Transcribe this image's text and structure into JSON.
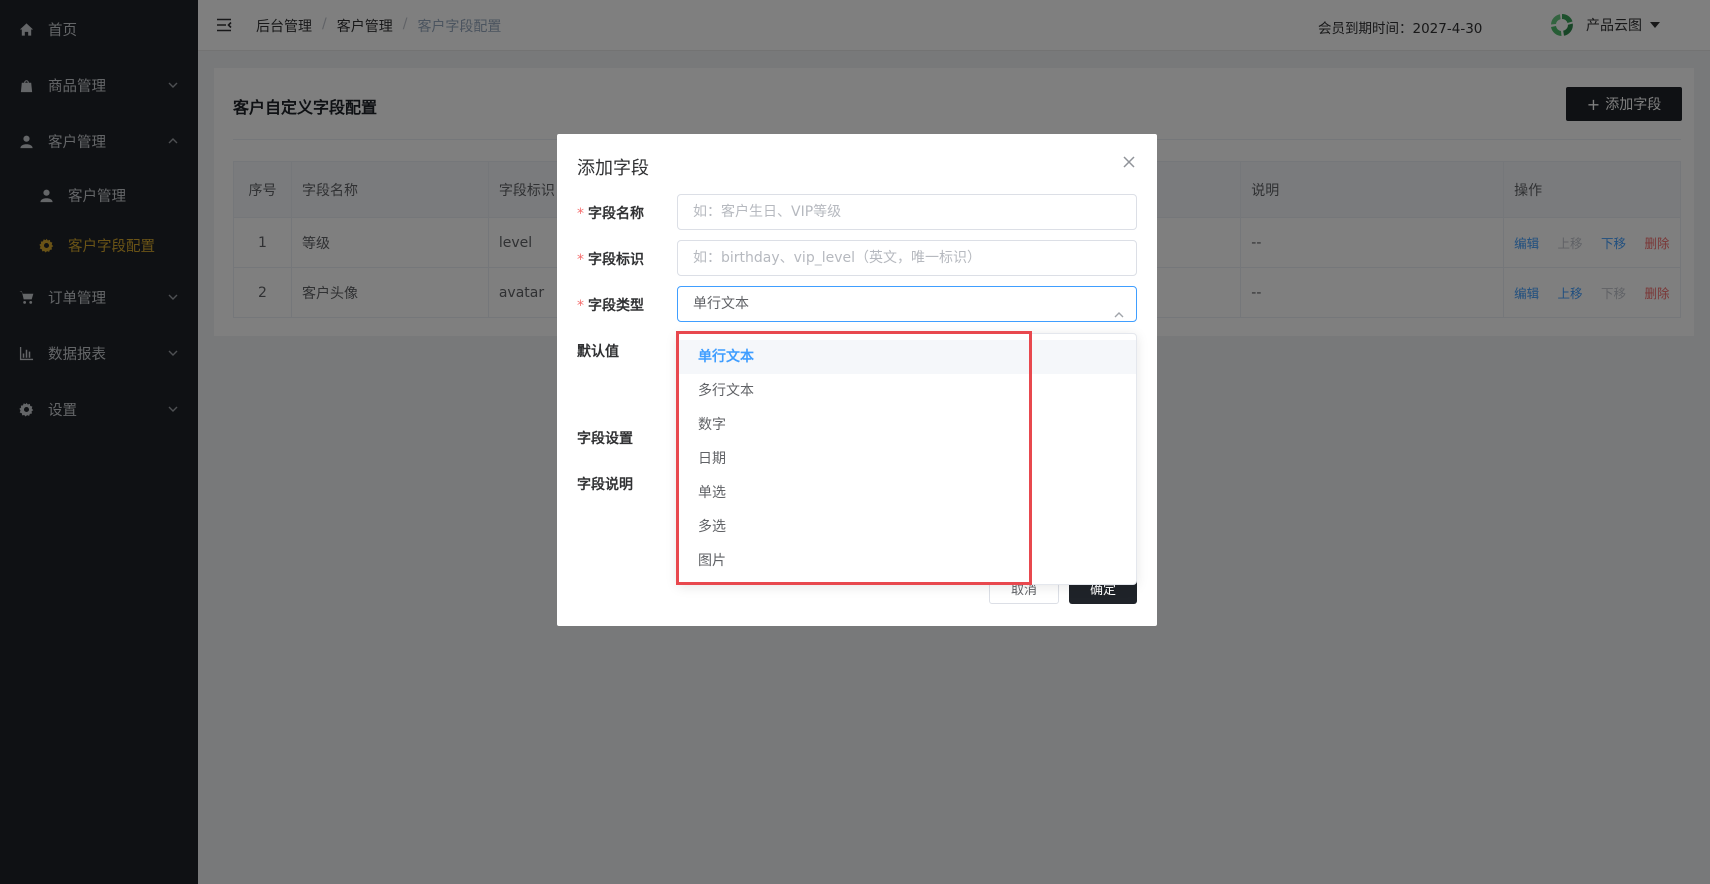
{
  "sidebar": {
    "items": [
      {
        "label": "首页",
        "icon": "home-icon"
      },
      {
        "label": "商品管理",
        "icon": "bag-icon"
      },
      {
        "label": "客户管理",
        "icon": "user-icon"
      },
      {
        "label": "客户管理",
        "icon": "user-icon"
      },
      {
        "label": "客户字段配置",
        "icon": "gear-icon"
      },
      {
        "label": "订单管理",
        "icon": "cart-icon"
      },
      {
        "label": "数据报表",
        "icon": "chart-icon"
      },
      {
        "label": "设置",
        "icon": "gear-icon"
      }
    ],
    "active_color": "#d4a72c"
  },
  "header": {
    "breadcrumb": [
      "后台管理",
      "客户管理",
      "客户字段配置"
    ],
    "separator": "/",
    "expire_label": "会员到期时间：2027-4-30",
    "user_name": "产品云图"
  },
  "card": {
    "title": "客户自定义字段配置",
    "add_button": "添加字段",
    "table": {
      "headers": [
        "序号",
        "字段名称",
        "字段标识",
        "说明",
        "操作"
      ],
      "rows": [
        {
          "index": "1",
          "name": "等级",
          "key": "level",
          "desc": "--"
        },
        {
          "index": "2",
          "name": "客户头像",
          "key": "avatar",
          "desc": "--"
        }
      ],
      "ops": {
        "edit": "编辑",
        "up": "上移",
        "down": "下移",
        "delete": "删除"
      }
    }
  },
  "dialog": {
    "title": "添加字段",
    "required_mark": "*",
    "fields": {
      "name_label": "字段名称",
      "name_placeholder": "如：客户生日、VIP等级",
      "key_label": "字段标识",
      "key_placeholder": "如：birthday、vip_level（英文，唯一标识）",
      "type_label": "字段类型",
      "type_value": "单行文本",
      "default_label": "默认值",
      "settings_label": "字段设置",
      "desc_label": "字段说明"
    },
    "cancel": "取消",
    "ok": "确定"
  },
  "dropdown": {
    "options": [
      "单行文本",
      "多行文本",
      "数字",
      "日期",
      "单选",
      "多选",
      "图片"
    ],
    "selected": "单行文本"
  },
  "colors": {
    "primary": "#409eff",
    "danger": "#f56c6c",
    "dark": "#1f2329",
    "highlight": "#e8484e"
  }
}
